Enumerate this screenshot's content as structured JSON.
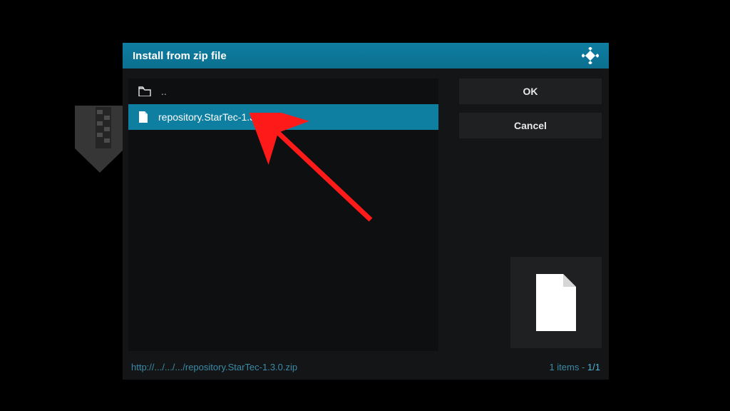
{
  "dialog": {
    "title": "Install from zip file",
    "ok_label": "OK",
    "cancel_label": "Cancel"
  },
  "files": {
    "parent_label": "..",
    "items": [
      {
        "name": "repository.StarTec-1.3.0.zip",
        "selected": true
      }
    ]
  },
  "status": {
    "path": "http://.../.../.../repository.StarTec-1.3.0.zip",
    "count_prefix": "1 items - ",
    "count_page": "1/1"
  }
}
